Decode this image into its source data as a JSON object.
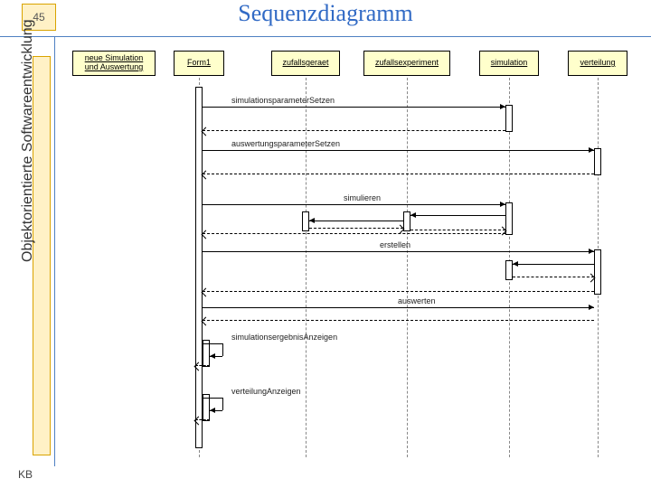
{
  "slide": {
    "number": "45",
    "title": "Sequenzdiagramm",
    "side_label": "Objektorientierte Softwareentwicklung",
    "footer": "KB"
  },
  "objects": [
    {
      "label": "neue Simulation und Auswertung"
    },
    {
      "label": "Form1"
    },
    {
      "label": "zufallsgeraet"
    },
    {
      "label": "zufallsexperiment"
    },
    {
      "label": "simulation"
    },
    {
      "label": "verteilung"
    }
  ],
  "messages": [
    {
      "text": "simulationsparameterSetzen"
    },
    {
      "text": "auswertungsparameterSetzen"
    },
    {
      "text": "simulieren"
    },
    {
      "text": "erstellen"
    },
    {
      "text": "auswerten"
    },
    {
      "text": "simulationsergebnisAnzeigen"
    },
    {
      "text": "verteilungAnzeigen"
    }
  ]
}
